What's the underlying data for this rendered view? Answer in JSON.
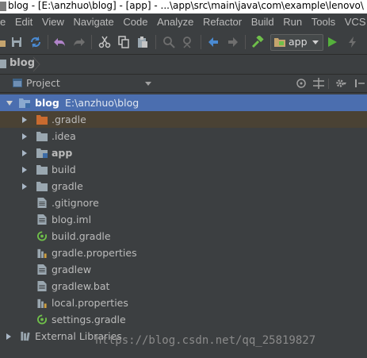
{
  "window": {
    "title": "blog - [E:\\anzhuo\\blog] - [app] - ...\\app\\src\\main\\java\\com\\example\\lenovo\\"
  },
  "menubar": {
    "items": [
      "e",
      "Edit",
      "View",
      "Navigate",
      "Code",
      "Analyze",
      "Refactor",
      "Build",
      "Run",
      "Tools",
      "VCS"
    ]
  },
  "toolbar": {
    "run_config": "app"
  },
  "navbar": {
    "crumb": "blog"
  },
  "panel": {
    "title": "Project"
  },
  "tree": {
    "root": {
      "name": "blog",
      "path": "E:\\anzhuo\\blog"
    },
    "items": [
      {
        "name": ".gradle"
      },
      {
        "name": ".idea"
      },
      {
        "name": "app"
      },
      {
        "name": "build"
      },
      {
        "name": "gradle"
      },
      {
        "name": ".gitignore"
      },
      {
        "name": "blog.iml"
      },
      {
        "name": "build.gradle"
      },
      {
        "name": "gradle.properties"
      },
      {
        "name": "gradlew"
      },
      {
        "name": "gradlew.bat"
      },
      {
        "name": "local.properties"
      },
      {
        "name": "settings.gradle"
      }
    ],
    "external": "External Libraries"
  },
  "watermark": "https://blog.csdn.net/qq_25819827",
  "colors": {
    "selection": "#4b6eaf",
    "background": "#3c3f41",
    "hover_row": "#4a4234"
  }
}
